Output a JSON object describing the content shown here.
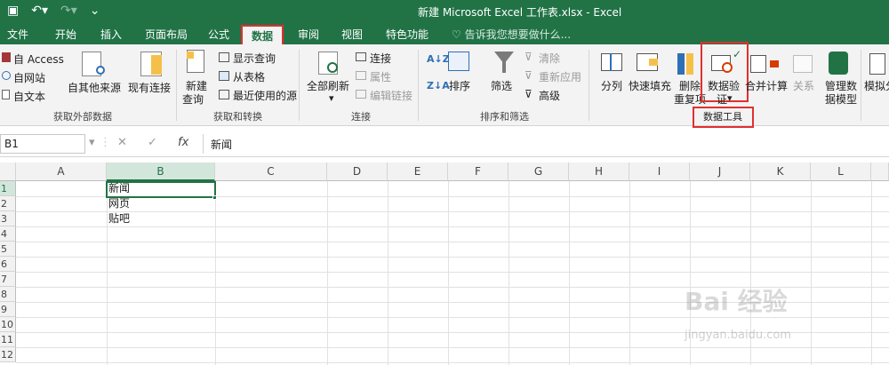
{
  "titlebar": {
    "title": "新建 Microsoft Excel 工作表.xlsx - Excel"
  },
  "tabs": {
    "file": "文件",
    "home": "开始",
    "insert": "插入",
    "page_layout": "页面布局",
    "formulas": "公式",
    "data": "数据",
    "review": "审阅",
    "view": "视图",
    "features": "特色功能",
    "tell_me": "告诉我您想要做什么..."
  },
  "ribbon": {
    "get_external": {
      "access": "自 Access",
      "web": "自网站",
      "text": "自文本",
      "other": "自其他来源",
      "existing": "现有连接",
      "label": "获取外部数据"
    },
    "get_transform": {
      "new_query": "新建",
      "new_query_2": "查询",
      "show_queries": "显示查询",
      "from_table": "从表格",
      "recent_sources": "最近使用的源",
      "label": "获取和转换"
    },
    "connections": {
      "refresh_all": "全部刷新",
      "connections": "连接",
      "properties": "属性",
      "edit_links": "编辑链接",
      "label": "连接"
    },
    "sort_filter": {
      "sort": "排序",
      "filter": "筛选",
      "clear": "清除",
      "reapply": "重新应用",
      "advanced": "高级",
      "label": "排序和筛选"
    },
    "data_tools": {
      "text_to_columns": "分列",
      "flash_fill": "快速填充",
      "remove_dup_1": "删除",
      "remove_dup_2": "重复项",
      "validation_1": "数据验",
      "validation_2": "证",
      "consolidate": "合并计算",
      "relationships": "关系",
      "manage_model_1": "管理数",
      "manage_model_2": "据模型",
      "label": "数据工具"
    },
    "forecast": {
      "what_if": "模拟分"
    }
  },
  "formula_bar": {
    "name_box": "B1",
    "fx": "fx",
    "content": "新闻"
  },
  "sheet": {
    "columns": [
      "A",
      "B",
      "C",
      "D",
      "E",
      "F",
      "G",
      "H",
      "I",
      "J",
      "K",
      "L"
    ],
    "rows": [
      "1",
      "2",
      "3",
      "4",
      "5",
      "6",
      "7",
      "8",
      "9",
      "10",
      "11",
      "12"
    ],
    "b1": "新闻",
    "b2": "网页",
    "b3": "贴吧"
  },
  "watermark": {
    "logo": "Bai 经验",
    "url": "jingyan.baidu.com"
  },
  "colors": {
    "excel_green": "#217346",
    "highlight_red": "#e03030"
  }
}
